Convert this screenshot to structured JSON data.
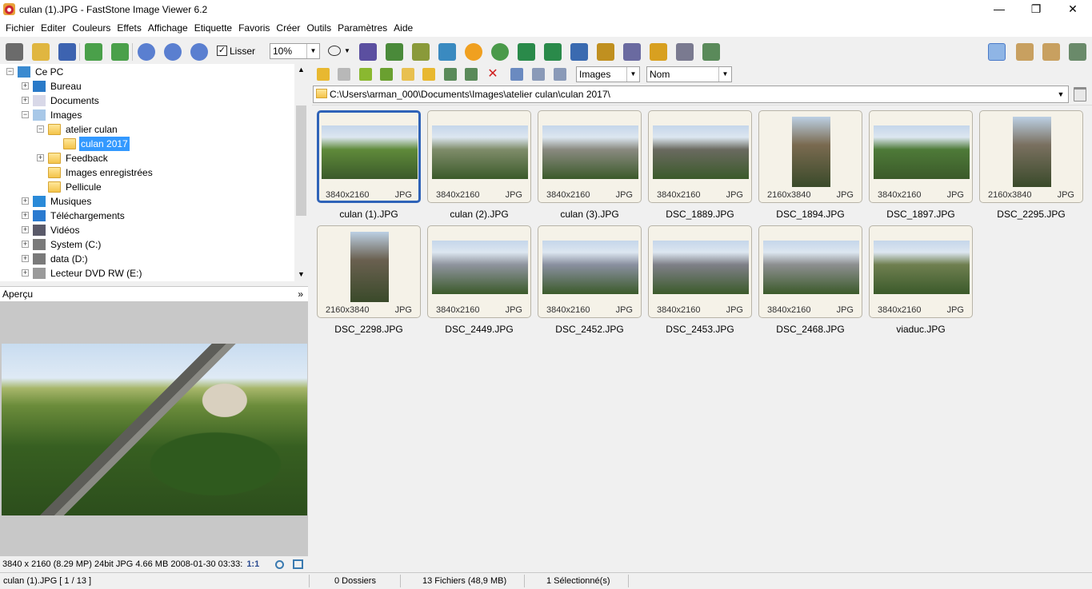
{
  "window": {
    "title": "culan (1).JPG  -  FastStone Image Viewer 6.2",
    "minimize": "—",
    "maximize": "❐",
    "close": "✕"
  },
  "menu": [
    "Fichier",
    "Editer",
    "Couleurs",
    "Effets",
    "Affichage",
    "Etiquette",
    "Favoris",
    "Créer",
    "Outils",
    "Paramètres",
    "Aide"
  ],
  "toolbar": {
    "smooth_label": "Lisser",
    "smooth_checked": true,
    "zoom_value": "10%",
    "dropdown_arrow": "▼"
  },
  "tree": {
    "items": [
      {
        "label": "Ce PC",
        "icon": "computer-icon",
        "expander": "−",
        "selected": false
      },
      {
        "label": "Bureau",
        "icon": "desktop-icon",
        "expander": "+",
        "selected": false
      },
      {
        "label": "Documents",
        "icon": "documents-icon",
        "expander": "+",
        "selected": false
      },
      {
        "label": "Images",
        "icon": "pictures-icon",
        "expander": "−",
        "selected": false
      },
      {
        "label": "atelier culan",
        "icon": "folder-icon",
        "expander": "−",
        "selected": false
      },
      {
        "label": "culan 2017",
        "icon": "folder-icon",
        "expander": "",
        "selected": true
      },
      {
        "label": "Feedback",
        "icon": "folder-icon",
        "expander": "+",
        "selected": false
      },
      {
        "label": "Images enregistrées",
        "icon": "folder-icon",
        "expander": "",
        "selected": false
      },
      {
        "label": "Pellicule",
        "icon": "folder-icon",
        "expander": "",
        "selected": false
      },
      {
        "label": "Musiques",
        "icon": "music-icon",
        "expander": "+",
        "selected": false
      },
      {
        "label": "Téléchargements",
        "icon": "download-icon",
        "expander": "+",
        "selected": false
      },
      {
        "label": "Vidéos",
        "icon": "video-icon",
        "expander": "+",
        "selected": false
      },
      {
        "label": "System (C:)",
        "icon": "drive-icon",
        "expander": "+",
        "selected": false
      },
      {
        "label": "data (D:)",
        "icon": "drive-icon",
        "expander": "+",
        "selected": false
      },
      {
        "label": "Lecteur DVD RW (E:)",
        "icon": "dvd-icon",
        "expander": "+",
        "selected": false
      }
    ]
  },
  "preview": {
    "header": "Aperçu",
    "collapse_glyph": "»",
    "info": "3840 x 2160 (8.29 MP)   24bit   JPG    4.66 MB    2008-01-30 03:33:",
    "ratio": "1:1"
  },
  "browser": {
    "filter": "Images",
    "sort": "Nom",
    "path": "C:\\Users\\arman_000\\Documents\\Images\\atelier culan\\culan 2017\\"
  },
  "thumbnails": [
    {
      "name": "culan (1).JPG",
      "dims": "3840x2160",
      "type": "JPG",
      "orientation": "landscape",
      "selected": true
    },
    {
      "name": "culan (2).JPG",
      "dims": "3840x2160",
      "type": "JPG",
      "orientation": "landscape",
      "selected": false
    },
    {
      "name": "culan (3).JPG",
      "dims": "3840x2160",
      "type": "JPG",
      "orientation": "landscape",
      "selected": false
    },
    {
      "name": "DSC_1889.JPG",
      "dims": "3840x2160",
      "type": "JPG",
      "orientation": "landscape",
      "selected": false
    },
    {
      "name": "DSC_1894.JPG",
      "dims": "2160x3840",
      "type": "JPG",
      "orientation": "portrait",
      "selected": false
    },
    {
      "name": "DSC_1897.JPG",
      "dims": "3840x2160",
      "type": "JPG",
      "orientation": "landscape",
      "selected": false
    },
    {
      "name": "DSC_2295.JPG",
      "dims": "2160x3840",
      "type": "JPG",
      "orientation": "portrait",
      "selected": false
    },
    {
      "name": "DSC_2298.JPG",
      "dims": "2160x3840",
      "type": "JPG",
      "orientation": "portrait",
      "selected": false
    },
    {
      "name": "DSC_2449.JPG",
      "dims": "3840x2160",
      "type": "JPG",
      "orientation": "landscape",
      "selected": false
    },
    {
      "name": "DSC_2452.JPG",
      "dims": "3840x2160",
      "type": "JPG",
      "orientation": "landscape",
      "selected": false
    },
    {
      "name": "DSC_2453.JPG",
      "dims": "3840x2160",
      "type": "JPG",
      "orientation": "landscape",
      "selected": false
    },
    {
      "name": "DSC_2468.JPG",
      "dims": "3840x2160",
      "type": "JPG",
      "orientation": "landscape",
      "selected": false
    },
    {
      "name": "viaduc.JPG",
      "dims": "3840x2160",
      "type": "JPG",
      "orientation": "landscape",
      "selected": false
    }
  ],
  "thumb_colors": [
    "#5f8a3a",
    "#7f8c6a",
    "#8a8a80",
    "#6a6a60",
    "#7a6a50",
    "#4e7a38",
    "#7a7060",
    "#6a6050",
    "#8f949e",
    "#8a90a0",
    "#7f8088",
    "#8d8f90",
    "#6f7f50"
  ],
  "status": {
    "file": "culan (1).JPG [ 1 / 13 ]",
    "folders": "0 Dossiers",
    "files": "13 Fichiers (48,9 MB)",
    "selected": "1 Sélectionné(s)"
  }
}
